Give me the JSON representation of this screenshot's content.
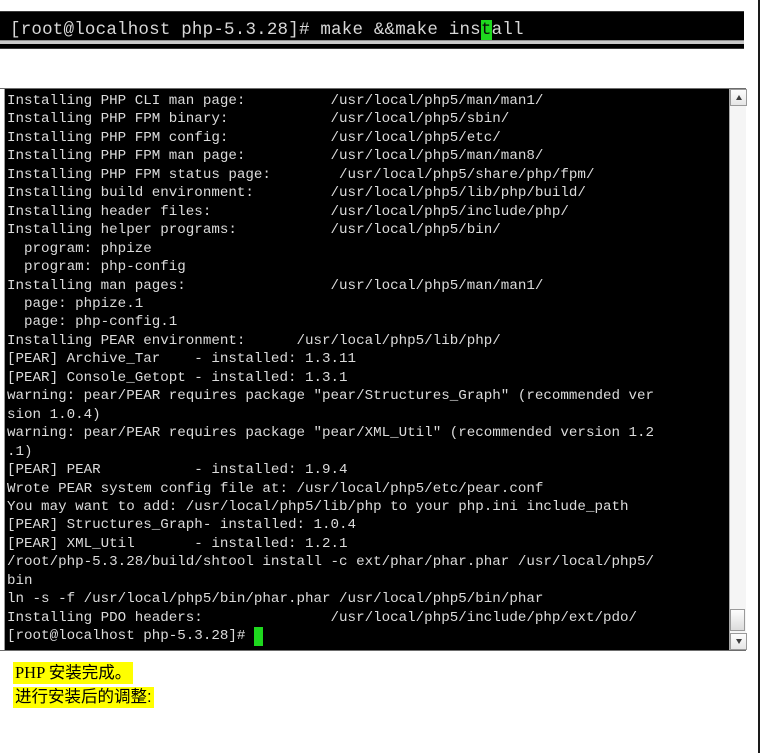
{
  "command_bar": {
    "prompt": "[root@localhost php-5.3.28]# make &&make ins",
    "cursor_char": "t",
    "after_cursor": "all"
  },
  "terminal": {
    "lines": [
      "Installing PHP CLI man page:          /usr/local/php5/man/man1/",
      "Installing PHP FPM binary:            /usr/local/php5/sbin/",
      "Installing PHP FPM config:            /usr/local/php5/etc/",
      "Installing PHP FPM man page:          /usr/local/php5/man/man8/",
      "Installing PHP FPM status page:        /usr/local/php5/share/php/fpm/",
      "Installing build environment:         /usr/local/php5/lib/php/build/",
      "Installing header files:              /usr/local/php5/include/php/",
      "Installing helper programs:           /usr/local/php5/bin/",
      "  program: phpize",
      "  program: php-config",
      "Installing man pages:                 /usr/local/php5/man/man1/",
      "  page: phpize.1",
      "  page: php-config.1",
      "Installing PEAR environment:      /usr/local/php5/lib/php/",
      "[PEAR] Archive_Tar    - installed: 1.3.11",
      "[PEAR] Console_Getopt - installed: 1.3.1",
      "warning: pear/PEAR requires package \"pear/Structures_Graph\" (recommended ver",
      "sion 1.0.4)",
      "warning: pear/PEAR requires package \"pear/XML_Util\" (recommended version 1.2",
      ".1)",
      "[PEAR] PEAR           - installed: 1.9.4",
      "Wrote PEAR system config file at: /usr/local/php5/etc/pear.conf",
      "You may want to add: /usr/local/php5/lib/php to your php.ini include_path",
      "[PEAR] Structures_Graph- installed: 1.0.4",
      "[PEAR] XML_Util       - installed: 1.2.1",
      "/root/php-5.3.28/build/shtool install -c ext/phar/phar.phar /usr/local/php5/",
      "bin",
      "ln -s -f /usr/local/php5/bin/phar.phar /usr/local/php5/bin/phar",
      "Installing PDO headers:               /usr/local/php5/include/php/ext/pdo/"
    ],
    "final_prompt": "[root@localhost php-5.3.28]# ",
    "cursor_color": "#1ed81e",
    "background": "#000000",
    "foreground": "#dcdcdc"
  },
  "scrollbar": {
    "up_arrow": "scroll-up-arrow",
    "down_arrow": "scroll-down-arrow"
  },
  "notes": {
    "line1": "PHP 安装完成。",
    "line2": "进行安装后的调整:",
    "highlight_color": "#ffff00"
  }
}
